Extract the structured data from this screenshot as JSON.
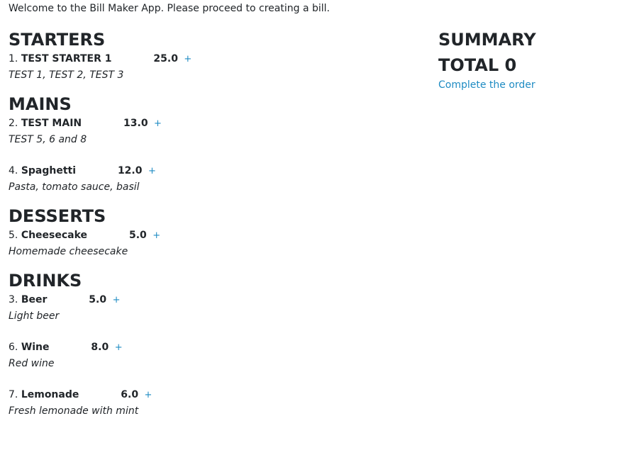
{
  "welcome_text": "Welcome to the Bill Maker App. Please proceed to creating a bill.",
  "add_label": "+",
  "sections": [
    {
      "title": "STARTERS",
      "items": [
        {
          "number": "1.",
          "name": "TEST STARTER 1",
          "price": "25.0",
          "description": "TEST 1, TEST 2, TEST 3"
        }
      ]
    },
    {
      "title": "MAINS",
      "items": [
        {
          "number": "2.",
          "name": "TEST MAIN",
          "price": "13.0",
          "description": "TEST 5, 6 and 8"
        },
        {
          "number": "4.",
          "name": "Spaghetti",
          "price": "12.0",
          "description": "Pasta, tomato sauce, basil"
        }
      ]
    },
    {
      "title": "DESSERTS",
      "items": [
        {
          "number": "5.",
          "name": "Cheesecake",
          "price": "5.0",
          "description": "Homemade cheesecake"
        }
      ]
    },
    {
      "title": "DRINKS",
      "items": [
        {
          "number": "3.",
          "name": "Beer",
          "price": "5.0",
          "description": "Light beer"
        },
        {
          "number": "6.",
          "name": "Wine",
          "price": "8.0",
          "description": "Red wine"
        },
        {
          "number": "7.",
          "name": "Lemonade",
          "price": "6.0",
          "description": "Fresh lemonade with mint"
        }
      ]
    }
  ],
  "summary": {
    "title": "SUMMARY",
    "total_text": "TOTAL 0",
    "complete_label": "Complete the order"
  },
  "colors": {
    "link": "#1e8bc3",
    "text": "#212529"
  }
}
